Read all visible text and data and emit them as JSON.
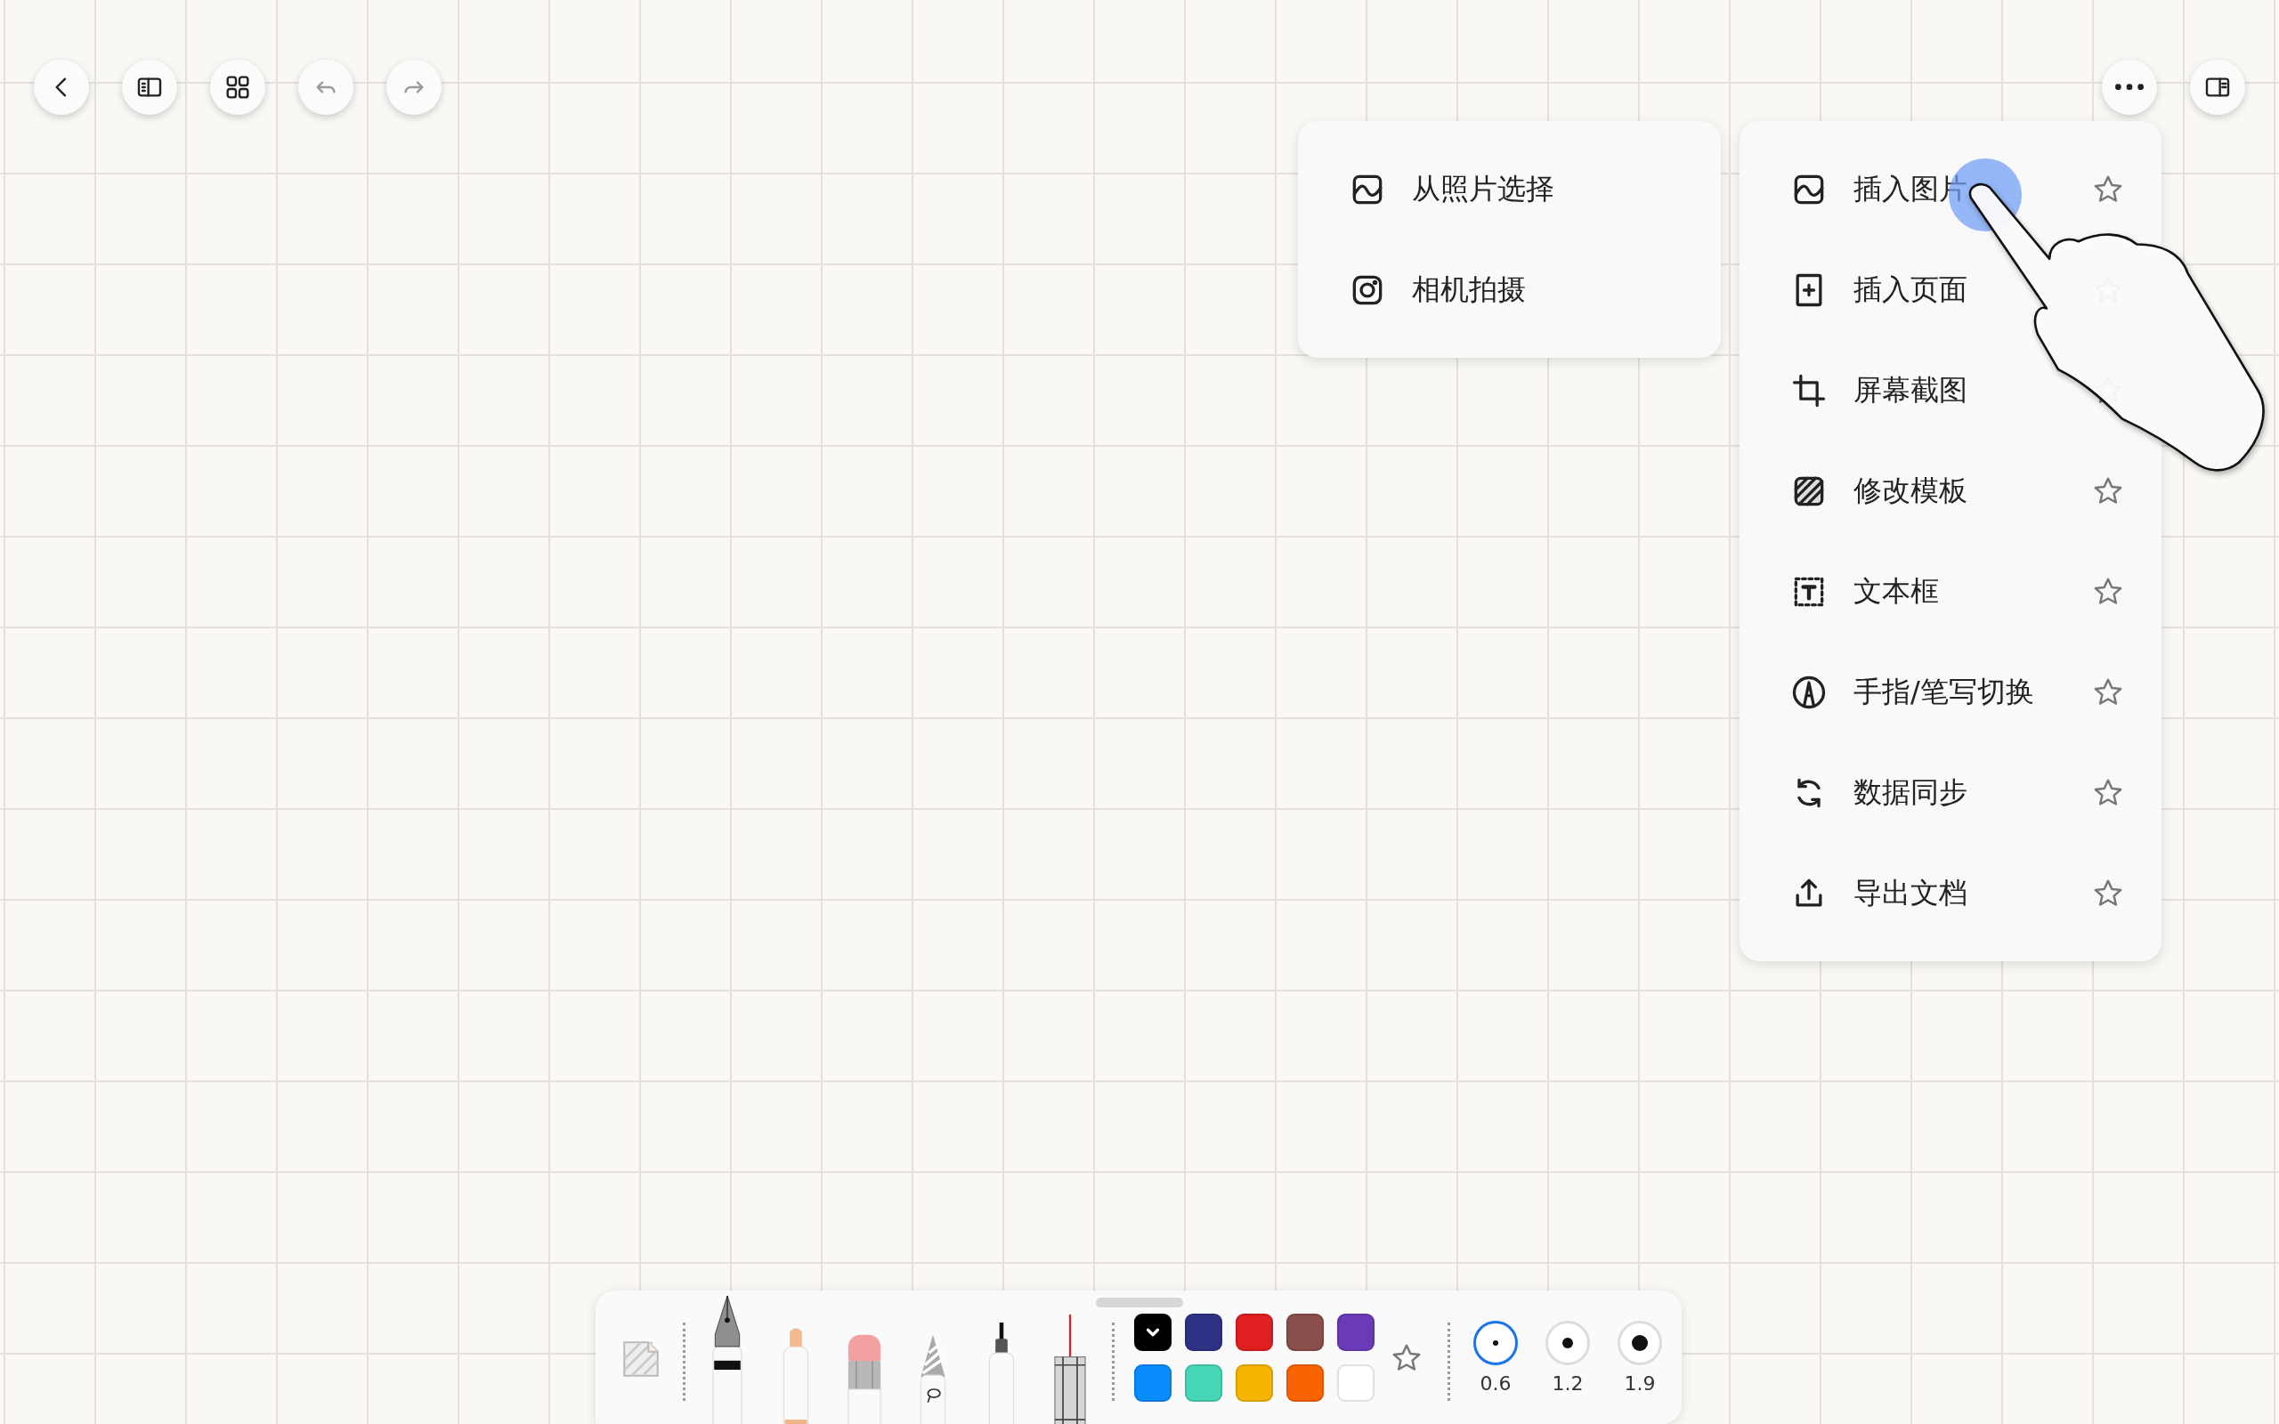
{
  "top_toolbar": {
    "left_buttons": [
      {
        "kind": "back",
        "disabled": false
      },
      {
        "kind": "outline",
        "disabled": false
      },
      {
        "kind": "grid",
        "disabled": false
      },
      {
        "kind": "undo",
        "disabled": true
      },
      {
        "kind": "redo",
        "disabled": true
      }
    ],
    "right_buttons": [
      {
        "kind": "more",
        "disabled": false
      },
      {
        "kind": "panel",
        "disabled": false
      }
    ]
  },
  "photo_submenu": {
    "items": [
      {
        "kind": "photo",
        "label": "从照片选择"
      },
      {
        "kind": "camera",
        "label": "相机拍摄"
      }
    ]
  },
  "more_menu": {
    "items": [
      {
        "kind": "image",
        "label": "插入图片",
        "favorite": false
      },
      {
        "kind": "page",
        "label": "插入页面",
        "favorite": false
      },
      {
        "kind": "screenshot",
        "label": "屏幕截图",
        "favorite": false
      },
      {
        "kind": "template",
        "label": "修改模板",
        "favorite": false
      },
      {
        "kind": "textbox",
        "label": "文本框",
        "favorite": false
      },
      {
        "kind": "input_mode",
        "label": "手指/笔写切换",
        "favorite": false
      },
      {
        "kind": "sync",
        "label": "数据同步",
        "favorite": false
      },
      {
        "kind": "export",
        "label": "导出文档",
        "favorite": false
      }
    ]
  },
  "bottom_toolbar": {
    "tools": [
      {
        "kind": "fountain_pen",
        "selected": true
      },
      {
        "kind": "marker",
        "selected": false
      },
      {
        "kind": "eraser",
        "selected": false
      },
      {
        "kind": "lasso",
        "selected": false
      },
      {
        "kind": "pen",
        "selected": false
      },
      {
        "kind": "needle",
        "selected": false
      }
    ],
    "colors": [
      {
        "color": "#000000",
        "selected": true
      },
      {
        "color": "#2f3185",
        "selected": false
      },
      {
        "color": "#e02020",
        "selected": false
      },
      {
        "color": "#8a4e4c",
        "selected": false
      },
      {
        "color": "#6a3ab8",
        "selected": false
      },
      {
        "color": "#0a8cff",
        "selected": false
      },
      {
        "color": "#47d6b6",
        "selected": false
      },
      {
        "color": "#f7b500",
        "selected": false
      },
      {
        "color": "#fa6400",
        "selected": false
      },
      {
        "color": "#ffffff",
        "selected": false
      }
    ],
    "favorite": false,
    "stroke_sizes": [
      {
        "label": "0.6",
        "selected": true
      },
      {
        "label": "1.2",
        "selected": false
      },
      {
        "label": "1.9",
        "selected": false
      }
    ]
  }
}
